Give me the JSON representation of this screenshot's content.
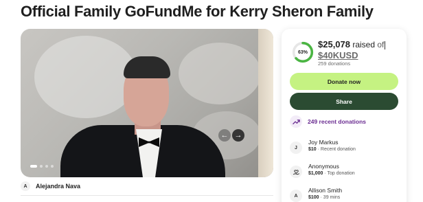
{
  "page": {
    "title": "Official Family GoFundMe for Kerry Sheron Family"
  },
  "photo": {
    "slides_total": 4,
    "active_slide": 1
  },
  "organizer": {
    "initial": "A",
    "name": "Alejandra Nava"
  },
  "progress": {
    "percent_label": "63%",
    "fraction": 0.63,
    "raised_amount": "$25,078",
    "raised_word": "raised",
    "of_word": "of",
    "goal": "$40KUSD",
    "donations": "259 donations",
    "ring_color": "#4bb543",
    "ring_track_color": "#e6e6e6"
  },
  "actions": {
    "donate_label": "Donate now",
    "share_label": "Share",
    "donate_color": "#c5f282",
    "share_color": "#2b4b32"
  },
  "recent": {
    "icon": "trending-up-icon",
    "label": "249 recent donations"
  },
  "donors": [
    {
      "initial": "J",
      "icon": "",
      "name": "Joy Markus",
      "amount": "$10",
      "note": " · Recent donation"
    },
    {
      "initial": "",
      "icon": "heart-hand-icon",
      "name": "Anonymous",
      "amount": "$1,000",
      "note": " · Top donation"
    },
    {
      "initial": "A",
      "icon": "",
      "name": "Allison Smith",
      "amount": "$100",
      "note": " · 39 mins"
    }
  ]
}
